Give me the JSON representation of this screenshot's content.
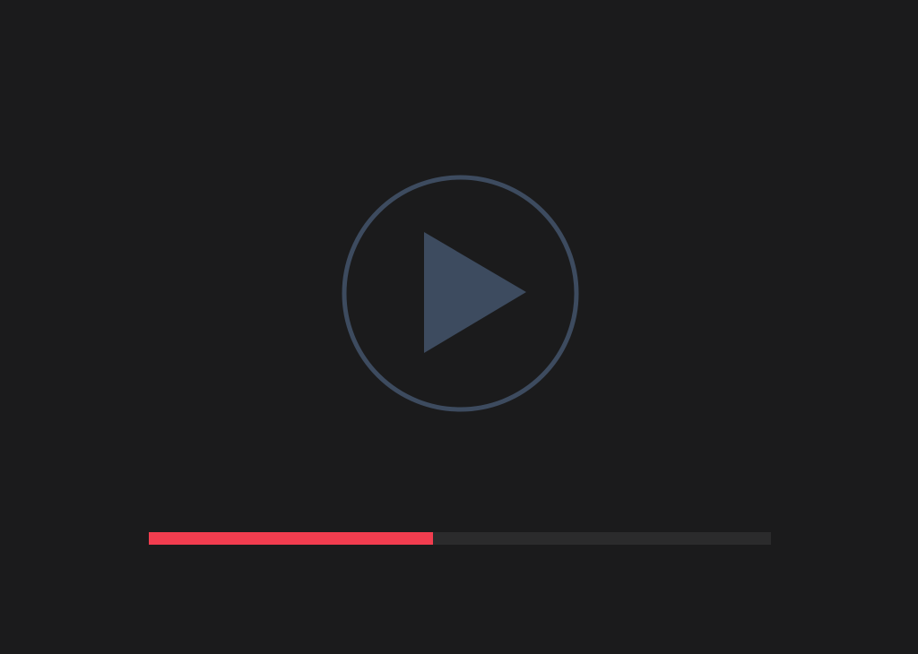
{
  "player": {
    "play_button": {
      "icon": "play-icon",
      "ring_color": "#3d4b5f",
      "triangle_color": "#3d4b5f"
    },
    "progress": {
      "fraction": 0.457,
      "fill_color": "#f23d4f",
      "track_color": "#2b2b2c"
    },
    "background_color": "#1b1b1c"
  }
}
